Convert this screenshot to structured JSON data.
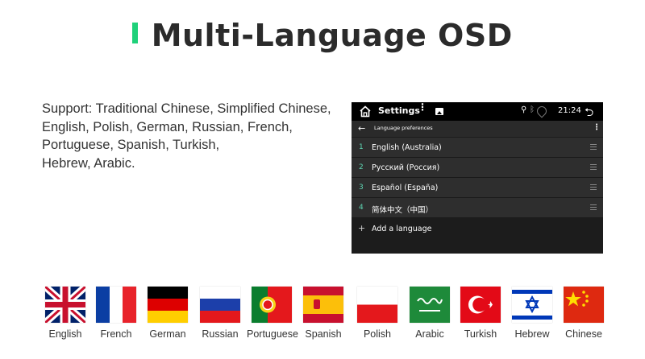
{
  "title": "Multi-Language OSD",
  "colors": {
    "accent": "#1fd17a",
    "teal": "#5fd6b3"
  },
  "support_lines": [
    "Support: Traditional Chinese, Simplified Chinese,",
    "English, Polish, German, Russian, French,",
    "Portuguese, Spanish, Turkish,",
    "Hebrew, Arabic."
  ],
  "screen": {
    "status": {
      "app_title": "Settings",
      "time": "21:24",
      "icons": [
        "home-icon",
        "more-vert-icon",
        "image-icon",
        "location-icon",
        "bluetooth-icon",
        "wifi-icon",
        "back-icon"
      ]
    },
    "subbar": {
      "title": "Language preferences"
    },
    "languages": [
      {
        "num": "1",
        "name": "English (Australia)"
      },
      {
        "num": "2",
        "name": "Русский (Россия)"
      },
      {
        "num": "3",
        "name": "Español (España)"
      },
      {
        "num": "4",
        "name": "简体中文（中国）"
      }
    ],
    "add_label": "Add a language"
  },
  "flags": [
    {
      "label": "English"
    },
    {
      "label": "French"
    },
    {
      "label": "German"
    },
    {
      "label": "Russian"
    },
    {
      "label": "Portuguese"
    },
    {
      "label": "Spanish"
    },
    {
      "label": "Polish"
    },
    {
      "label": "Arabic"
    },
    {
      "label": "Turkish"
    },
    {
      "label": "Hebrew"
    },
    {
      "label": "Chinese"
    }
  ]
}
